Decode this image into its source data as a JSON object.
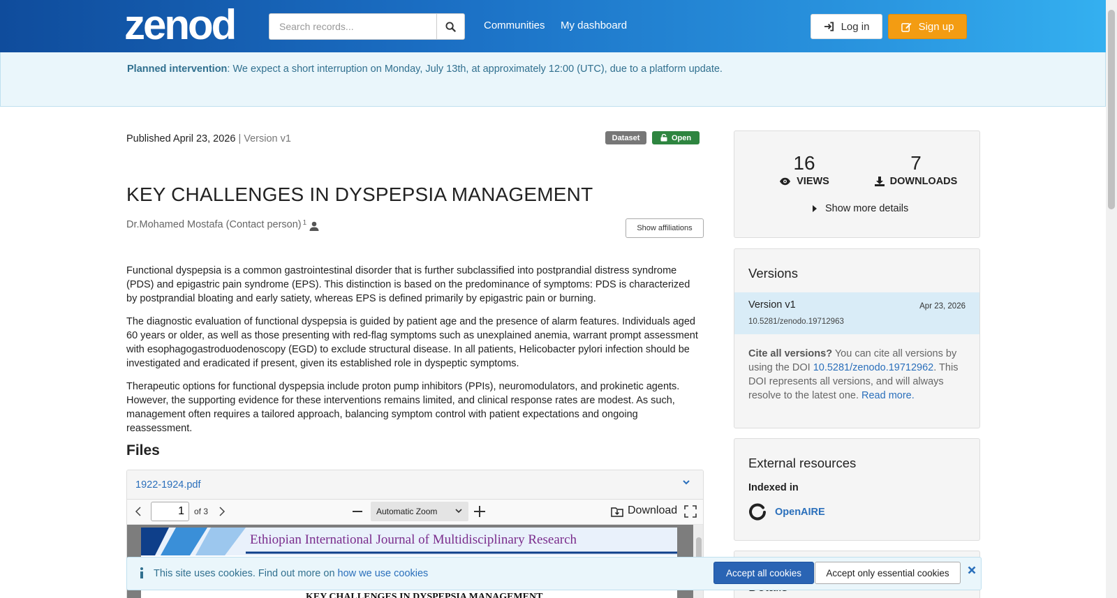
{
  "colors": {
    "brand": "#1b6fc4",
    "accent": "#f39c12",
    "link": "#2a6fbb",
    "open_badge": "#2e8540",
    "info_text": "#31708f"
  },
  "header": {
    "logo_text": "zenodo",
    "search": {
      "placeholder": "Search records...",
      "value": ""
    },
    "nav": {
      "communities": "Communities",
      "dashboard": "My dashboard"
    },
    "login": "Log in",
    "signup": "Sign up",
    "icons": {
      "search": "search-icon",
      "login": "sign-in-icon",
      "signup": "edit-icon"
    }
  },
  "banner": {
    "title": "Planned intervention",
    "message": ": We expect a short interruption on Monday, July 13th, at approximately 12:00 (UTC), due to a platform update."
  },
  "record": {
    "published": "Published April 23, 2026",
    "version": "| Version v1",
    "badges": {
      "type": "Dataset",
      "access": "Open"
    },
    "title": "KEY CHALLENGES IN DYSPEPSIA MANAGEMENT",
    "author": "Dr.Mohamed Mostafa (Contact person)",
    "author_sup": "1",
    "show_affiliations": "Show affiliations",
    "paragraphs": [
      "Functional dyspepsia is a common gastrointestinal disorder that is further subclassified into postprandial distress syndrome (PDS) and epigastric pain syndrome (EPS). This distinction is based on the predominance of symptoms: PDS is characterized by postprandial bloating and early satiety, whereas EPS is defined primarily by epigastric pain or burning.",
      "The diagnostic evaluation of functional dyspepsia is guided by patient age and the presence of alarm features. Individuals aged 60 years or older, as well as those presenting with red-flag symptoms such as unexplained anemia, warrant prompt assessment with esophagogastroduodenoscopy (EGD) to exclude structural disease. In all patients, Helicobacter pylori infection should be investigated and eradicated if present, given its established role in dyspeptic symptoms.",
      "Therapeutic options for functional dyspepsia include proton pump inhibitors (PPIs), neuromodulators, and prokinetic agents. However, the supporting evidence for these interventions remains limited, and clinical response rates are modest. As such, management often requires a tailored approach, balancing symptom control with patient expectations and ongoing reassessment."
    ]
  },
  "files": {
    "heading": "Files",
    "file_name": "1922-1924.pdf",
    "viewer": {
      "page": "1",
      "page_count": "of 3",
      "zoom": "Automatic Zoom",
      "download": "Download",
      "journal": "Ethiopian International Journal of Multidisciplinary Research",
      "doc_title": "KEY CHALLENGES IN DYSPEPSIA MANAGEMENT"
    }
  },
  "stats": {
    "views": "16",
    "views_label": "VIEWS",
    "downloads": "7",
    "downloads_label": "DOWNLOADS",
    "more": "Show more details"
  },
  "versions": {
    "title": "Versions",
    "items": [
      {
        "name": "Version v1",
        "date": "Apr 23, 2026",
        "doi": "10.5281/zenodo.19712963"
      }
    ],
    "cite_bold": "Cite all versions?",
    "cite_1": " You can cite all versions by using the DOI ",
    "cite_doi": "10.5281/zenodo.19712962",
    "cite_2": ". This DOI represents all versions, and will always resolve to the latest one. ",
    "read_more": "Read more."
  },
  "external": {
    "title": "External resources",
    "indexed_in": "Indexed in",
    "openaire": "OpenAIRE"
  },
  "details": {
    "title": "Details"
  },
  "cookies": {
    "text": "This site uses cookies. Find out more on ",
    "link": "how we use cookies",
    "accept_all": "Accept all cookies",
    "accept_essential": "Accept only essential cookies"
  }
}
